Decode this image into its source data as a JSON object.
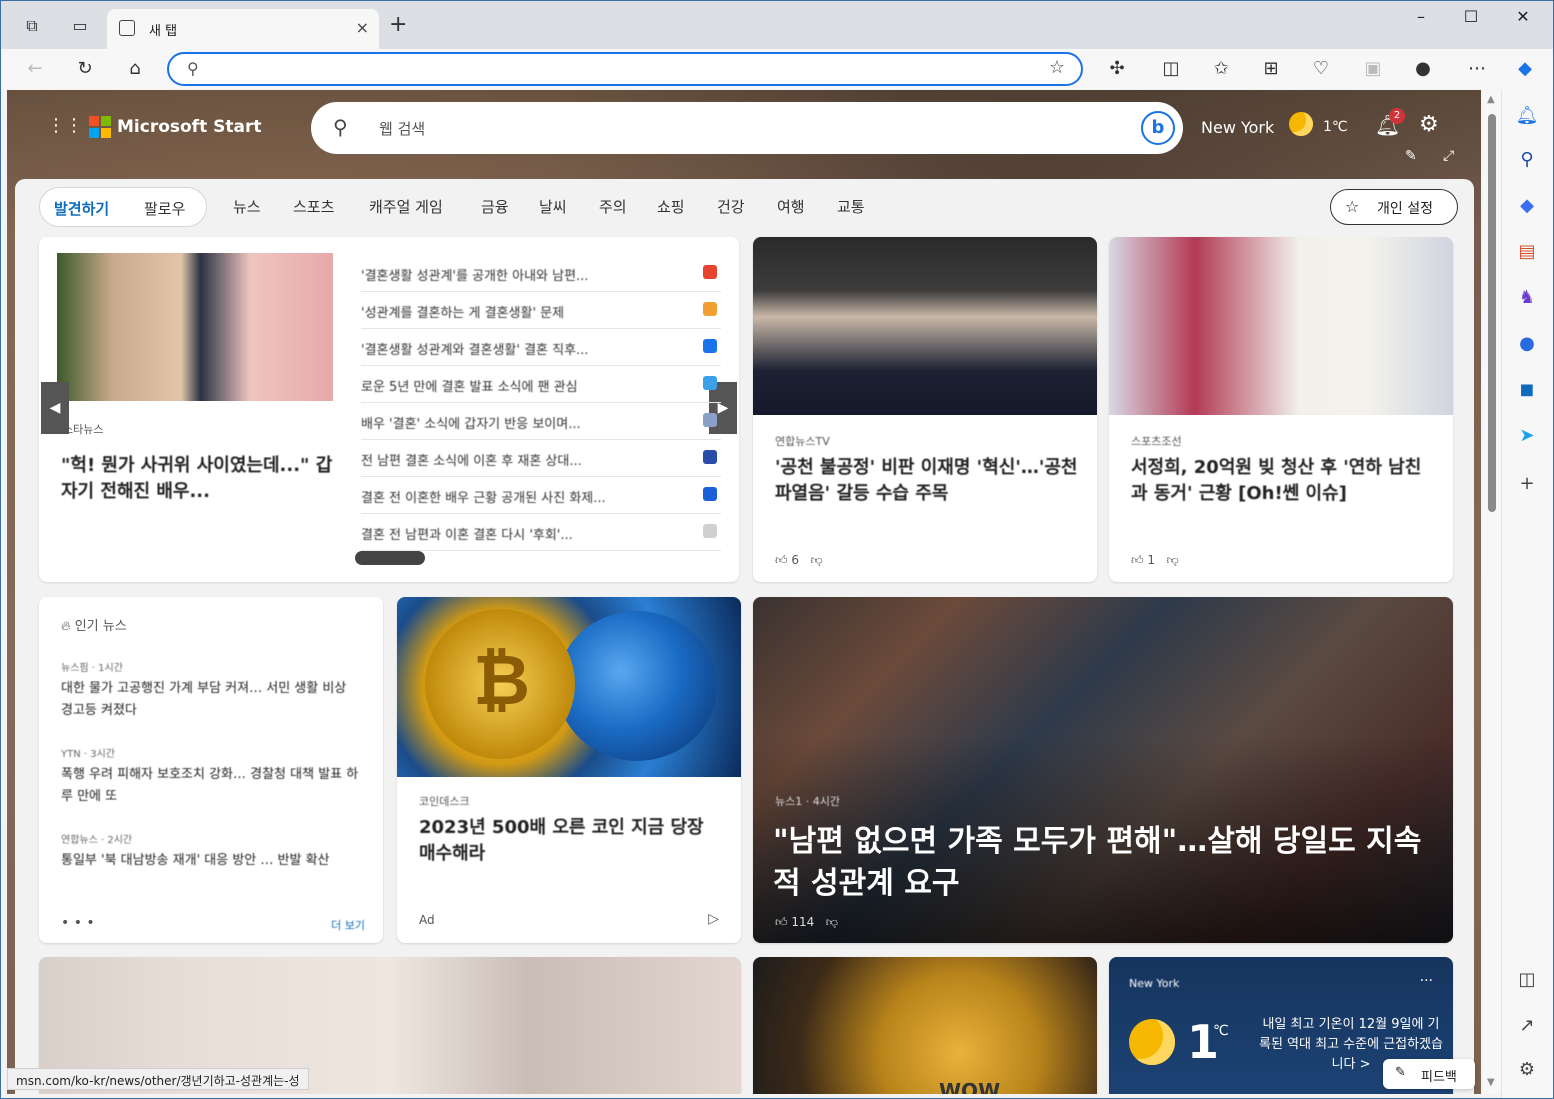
{
  "browser": {
    "tab_title": "새 탭",
    "tab_close": "×",
    "new_tab": "+",
    "window_controls": {
      "minimize": "–",
      "maximize": "☐",
      "close": "✕"
    },
    "address_placeholder": "",
    "status_url": "msn.com/ko-kr/news/other/갱년기하고-성관계는-성"
  },
  "msn": {
    "brand": "Microsoft Start",
    "search_placeholder": "웹 검색",
    "bing_label": "b",
    "location": "New York",
    "temperature": "1℃",
    "notification_count": "2"
  },
  "nav": {
    "discover": "발견하기",
    "follow": "팔로우",
    "items": [
      "뉴스",
      "스포츠",
      "캐주얼 게임",
      "금융",
      "날씨",
      "주의",
      "쇼핑",
      "건강",
      "여행",
      "교통"
    ],
    "personalize": "개인 설정"
  },
  "carousel": {
    "source": "스타뉴스",
    "title": "\"헉! 뭔가 사귀위 사이였는데...\" 갑자기 전해진 배우...",
    "list": [
      "'결혼생활 성관계'를 공개한 아내와 남편...",
      "'성관계를 결혼하는 게 결혼생활' 문제",
      "'결혼생활 성관계와 결혼생활' 결혼 직후...",
      "로운 5년 만에 결혼 발표 소식에 팬 관심",
      "배우 '결혼' 소식에 갑자기 반응 보이며...",
      "전 남편 결혼 소식에 이혼 후 재혼 상대...",
      "결혼 전 이혼한 배우 근황 공개된 사진 화제...",
      "결혼 전 남편과 이혼 결혼 다시 '후회'..."
    ]
  },
  "card_lee": {
    "source": "연합뉴스TV",
    "title": "'공천 불공정' 비판 이재명 '혁신'…'공천 파열음' 갈등 수습 주목",
    "footer": "6"
  },
  "card_seo": {
    "source": "스포츠조선",
    "title": "서정희, 20억원 빚 청산 후 '연하 남친과 동거' 근황 [Oh!쎈 이슈]",
    "footer": "1"
  },
  "trending": {
    "title": "인기 뉴스",
    "items": [
      {
        "source": "뉴스핌 · 1시간",
        "headline": "대한 물가 고공행진 가계 부담 커져… 서민 생활 비상 경고등 켜졌다"
      },
      {
        "source": "YTN · 3시간",
        "headline": "폭행 우려 피해자 보호조치 강화… 경찰청 대책 발표 하루 만에 또"
      },
      {
        "source": "연합뉴스 · 2시간",
        "headline": "통일부 '북 대남방송 재개' 대응 방안 … 반발 확산"
      }
    ],
    "more": "• • •",
    "link": "더 보기"
  },
  "card_btc": {
    "source": "코인데스크",
    "title": "2023년 500배 오른 코인 지금 당장 매수해라",
    "footer": "Ad",
    "coin_symbol": "₿"
  },
  "card_feature": {
    "source": "뉴스1 · 4시간",
    "title": "\"남편 없으면 가족 모두가 편해\"…살해 당일도 지속적 성관계 요구",
    "footer": "114"
  },
  "card_doge": {
    "label": "WOW"
  },
  "weather": {
    "city": "New York",
    "dots": "···",
    "temp": "1",
    "unit": "℃",
    "note": "내일 최고 기온이 12월 9일에 기록된 역대 최고 수준에 근접하겠습니다 >"
  },
  "feedback": {
    "label": "피드백"
  }
}
